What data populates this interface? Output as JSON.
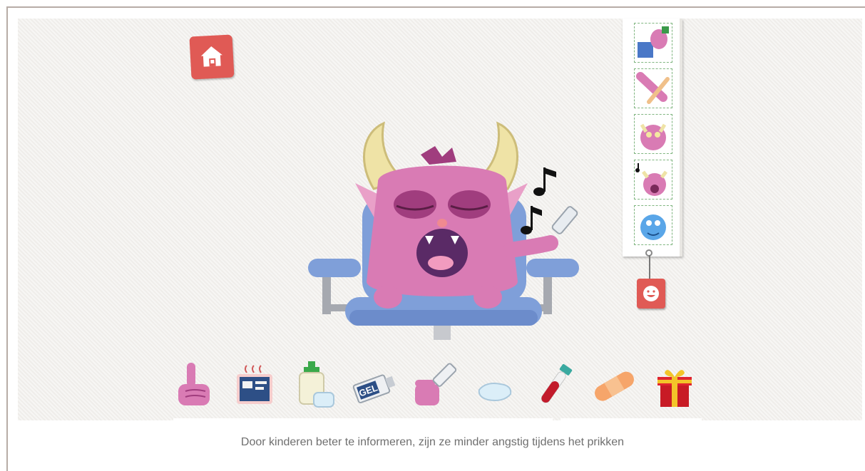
{
  "caption": "Door kinderen beter te informeren, zijn ze minder angstig tijdens het prikken",
  "colors": {
    "scene_bg": "#f3f1ee",
    "button_red": "#e05a55",
    "monster_pink": "#d97bb4",
    "monster_dark": "#a03d7e",
    "horn": "#efe3a6",
    "chair_blue": "#7f9fd9",
    "thumb_border": "#7fb57f"
  },
  "home_button": {
    "icon": "home-icon"
  },
  "story_strip": {
    "thumbnails": [
      {
        "icon": "monster-on-chair-thumbnail"
      },
      {
        "icon": "monster-arm-thumbnail"
      },
      {
        "icon": "monster-face-thumbnail"
      },
      {
        "icon": "monster-singing-thumbnail"
      },
      {
        "icon": "blue-monster-thumbnail"
      }
    ]
  },
  "emoji_button": {
    "icon": "smiley-icon"
  },
  "toolbar": {
    "tools": [
      {
        "icon": "pointing-hand-icon"
      },
      {
        "icon": "book-icon"
      },
      {
        "icon": "disinfectant-bottle-icon"
      },
      {
        "icon": "gel-tube-icon",
        "label": "GEL"
      },
      {
        "icon": "hand-with-tube-icon"
      },
      {
        "icon": "cotton-pad-icon"
      },
      {
        "icon": "blood-tube-icon"
      },
      {
        "icon": "bandage-icon"
      },
      {
        "icon": "gift-icon"
      }
    ]
  }
}
